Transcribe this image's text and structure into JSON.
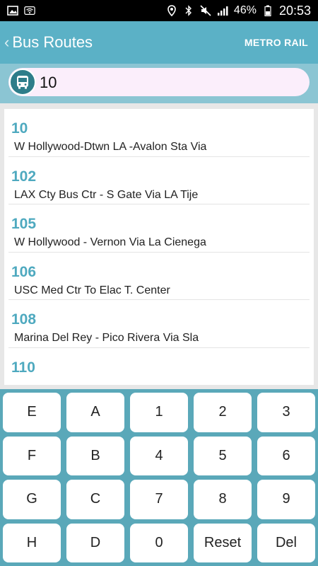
{
  "status_bar": {
    "battery": "46%",
    "time": "20:53",
    "icons_left": [
      "image-icon",
      "wifi-icon"
    ],
    "icons_right": [
      "location-icon",
      "bluetooth-icon",
      "mute-icon",
      "signal-icon",
      "battery-icon"
    ]
  },
  "app_bar": {
    "title": "Bus Routes",
    "action": "METRO RAIL"
  },
  "search": {
    "value": "10"
  },
  "routes": [
    {
      "number": "10",
      "desc": "W Hollywood-Dtwn LA -Avalon Sta Via"
    },
    {
      "number": "102",
      "desc": "LAX Cty Bus Ctr - S Gate Via LA Tije"
    },
    {
      "number": "105",
      "desc": "W Hollywood - Vernon Via La Cienega"
    },
    {
      "number": "106",
      "desc": "USC Med Ctr To Elac T. Center"
    },
    {
      "number": "108",
      "desc": "Marina Del Rey - Pico Rivera Via Sla"
    },
    {
      "number": "110",
      "desc": ""
    }
  ],
  "keypad": {
    "keys": [
      "E",
      "A",
      "1",
      "2",
      "3",
      "F",
      "B",
      "4",
      "5",
      "6",
      "G",
      "C",
      "7",
      "8",
      "9",
      "H",
      "D",
      "0",
      "Reset",
      "Del"
    ]
  },
  "colors": {
    "app_bar": "#5bb1c6",
    "route_number": "#4ea9bf",
    "keypad_bg": "#5aa8b9",
    "search_bg": "#fbeefb"
  }
}
